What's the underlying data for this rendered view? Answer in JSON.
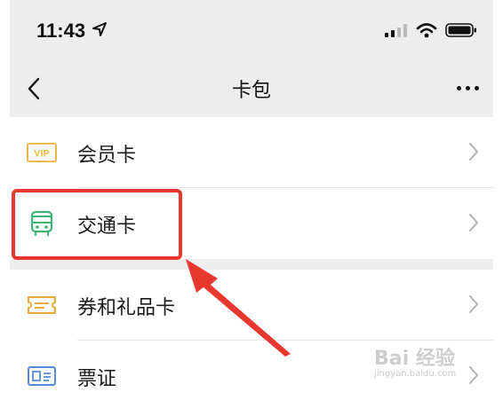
{
  "status_bar": {
    "time": "11:43",
    "icons": [
      "location-arrow-icon",
      "signal-icon",
      "wifi-icon",
      "battery-icon"
    ]
  },
  "nav": {
    "title": "卡包",
    "back_icon": "chevron-left-icon",
    "more_icon": "more-dots-icon"
  },
  "list": {
    "items": [
      {
        "label": "会员卡",
        "icon": "vip-card-icon",
        "icon_color": "#e8b84a"
      },
      {
        "label": "交通卡",
        "icon": "bus-icon",
        "icon_color": "#3eb575"
      },
      {
        "label": "券和礼品卡",
        "icon": "coupon-icon",
        "icon_color": "#e8a93a"
      },
      {
        "label": "票证",
        "icon": "id-card-icon",
        "icon_color": "#5a8bd6"
      }
    ]
  },
  "annotation": {
    "highlight_color": "#e8372f"
  },
  "watermark": {
    "logo": "Bai 经验",
    "url": "jingyan.baidu.com"
  }
}
